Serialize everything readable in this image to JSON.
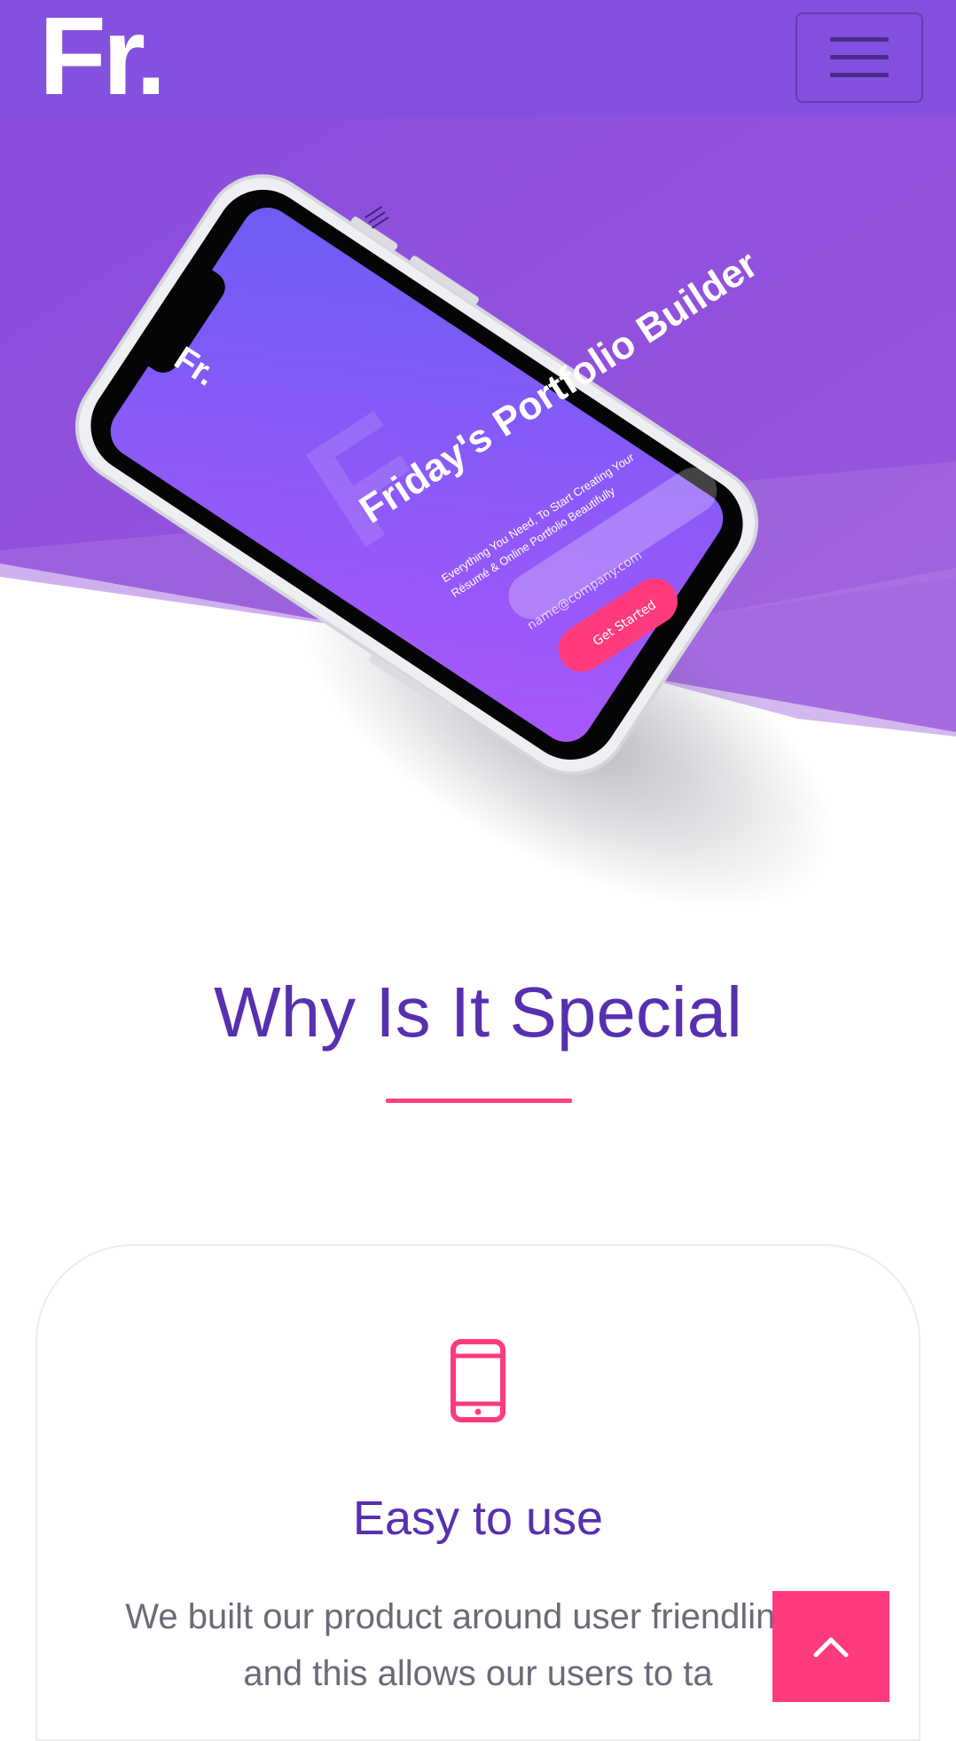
{
  "header": {
    "brand": "Fr.",
    "menu_icon": "hamburger-icon"
  },
  "hero_mockup": {
    "logo": "Fr.",
    "title": "Friday's Portfolio Builder",
    "subtitle": "Everything You Need, To Start Creating Your Résumé & Online Portfolio Beautifully",
    "email_placeholder": "name@company.com",
    "cta": "Get Started"
  },
  "section": {
    "title": "Why Is It Special"
  },
  "feature": {
    "icon": "mobile-phone-icon",
    "title": "Easy to use",
    "text": "We built our product around user friendliness and this allows our users to ta"
  },
  "scroll_top": {
    "icon": "chevron-up-icon"
  },
  "colors": {
    "brand_purple": "#8350df",
    "accent_pink": "#ff3b7d",
    "heading_purple": "#5730b0"
  }
}
